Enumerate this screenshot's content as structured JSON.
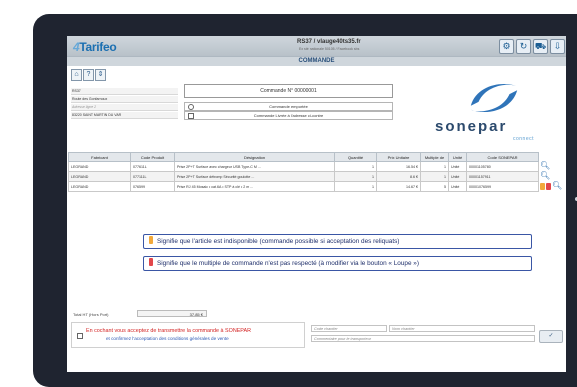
{
  "app": {
    "logo_text": "Tarifeo",
    "site": "RS37 / vlauge40ts35.fr",
    "site_sub": "Ex sté nationale 50105 / Facebook sbs"
  },
  "toolbar": {
    "icons": [
      "settings-icon",
      "refresh-icon",
      "cart-icon",
      "export-icon"
    ]
  },
  "page_title": "COMMANDE",
  "nav": {
    "icons": [
      "home-icon",
      "info-icon",
      "sort-icon"
    ]
  },
  "customer": {
    "lines": [
      "RS37",
      "Route des Gonfarnoux",
      "Adresse ligne 2",
      "83220 SAINT MARTIN DU VAR"
    ],
    "city_code": "83220",
    "city": "SAINT MARTIN DU VAR"
  },
  "order": {
    "number_label": "Commande N° 00000001",
    "option_pickup": "Commande emportée",
    "option_delivery": "Commande Livrée à l'adresse ci-contre"
  },
  "brand": {
    "name": "sonepar",
    "sub": "connect",
    "color": "#2c4a6d"
  },
  "table": {
    "headers": [
      "Fabricant",
      "Code Produit",
      "Désignation",
      "Quantité",
      "Prix Unitaire",
      "Multiple de",
      "Unité",
      "Code SONEPAR"
    ],
    "rows": [
      [
        "LEGRAND",
        "077611L",
        "Prise 2P+T Surface avec chargeur USB Type-C M ...",
        "1",
        "16.54 €",
        "1",
        "Unité",
        "00001105780",
        "loupe"
      ],
      [
        "LEGRAND",
        "077111L",
        "Prise 2P+T Surface détromp Sécurité goulotte ...",
        "1",
        "8.6 €",
        "1",
        "Unité",
        "00001157911",
        "loupe"
      ],
      [
        "LEGRAND",
        "076599",
        "Prise RJ 45 Mosaic • cat.6A • STP à clé • 2 m ...",
        "1",
        "14.67 €",
        "5",
        "Unité",
        "00001076599",
        "warning-loupe"
      ]
    ]
  },
  "legend": [
    {
      "text": "Signifie que l'article est indisponible (commande possible si acceptation des reliquats)",
      "color": "#f2a93b"
    },
    {
      "text": "Signifie que le multiple de commande n'est pas respecté (à modifier via le bouton « Loupe »)",
      "color": "#e2474b"
    }
  ],
  "total": {
    "label": "Total HT (Hors Port)",
    "value": "37.85 €"
  },
  "cgv": {
    "line1": "En cochant vous acceptez de transmettre la commande à SONEPAR",
    "line2": "et confirmez l'acceptation des conditions générales de vente"
  },
  "fields": {
    "code_chantier": "Code chantier",
    "nom_chantier": "Nom chantier",
    "comment": "Commentaire pour le transporteur"
  },
  "validate_label": "✓"
}
